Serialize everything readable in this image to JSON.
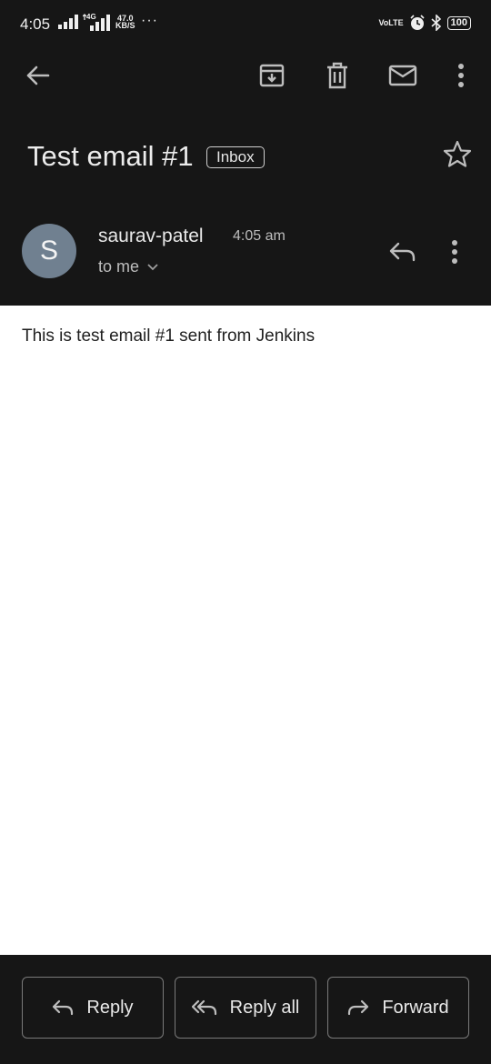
{
  "status_bar": {
    "time": "4:05",
    "network": "4G",
    "speed_value": "47.0",
    "speed_unit": "KB/S",
    "overflow": "···",
    "volte": "VoLTE",
    "battery": "100"
  },
  "toolbar": {
    "back_icon": "arrow-left-icon",
    "archive_icon": "archive-icon",
    "delete_icon": "trash-icon",
    "mark_unread_icon": "mail-icon",
    "more_icon": "more-vert-icon"
  },
  "email": {
    "subject": "Test email #1",
    "label": "Inbox",
    "sender_initial": "S",
    "sender_name": "saurav-patel",
    "time": "4:05 am",
    "recipients": "to me",
    "body": "This is test email #1 sent from Jenkins"
  },
  "actions": {
    "reply": "Reply",
    "reply_all": "Reply all",
    "forward": "Forward"
  },
  "colors": {
    "background": "#161616",
    "body_background": "#ffffff",
    "avatar": "#708090"
  }
}
